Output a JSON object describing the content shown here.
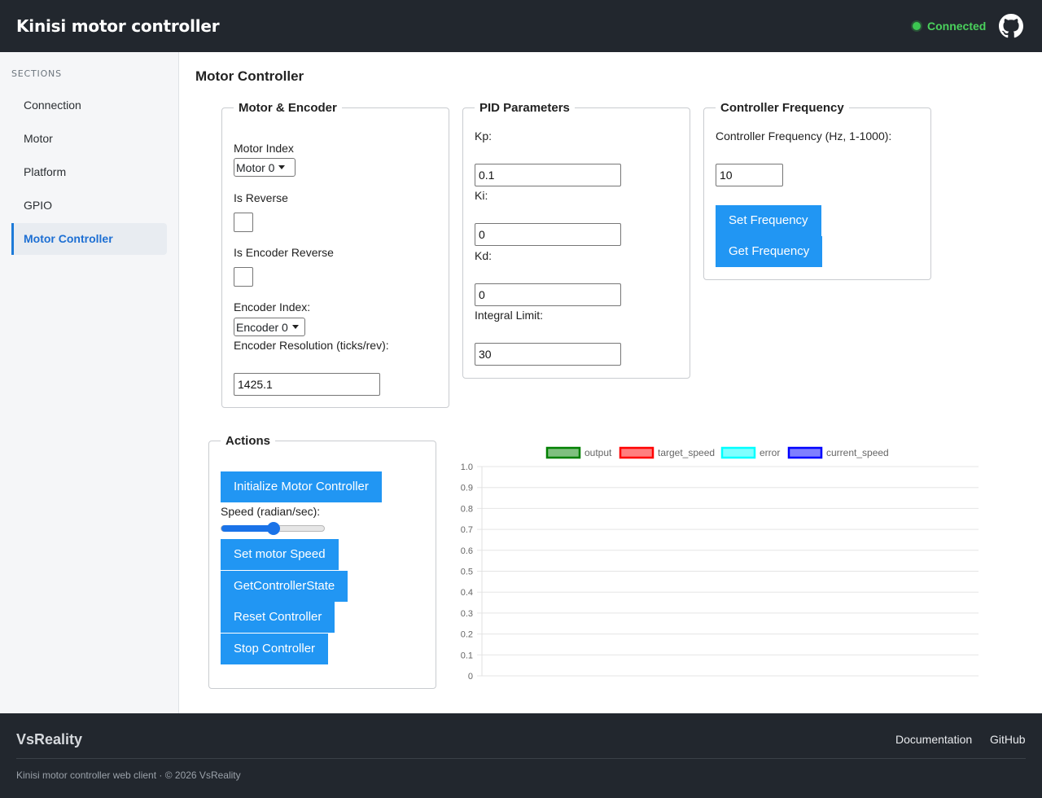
{
  "header": {
    "title": "Kinisi motor controller",
    "status": "Connected",
    "status_color": "#3cc651",
    "repo_icon": "github-icon"
  },
  "sidebar": {
    "heading": "SECTIONS",
    "items": [
      {
        "label": "Connection"
      },
      {
        "label": "Motor"
      },
      {
        "label": "Platform"
      },
      {
        "label": "GPIO"
      },
      {
        "label": "Motor Controller",
        "active": true
      }
    ]
  },
  "main": {
    "title": "Motor Controller",
    "motor_encoder": {
      "legend": "Motor & Encoder",
      "motor_index_label": "Motor Index",
      "motor_index_value": "Motor 0",
      "is_reverse_label": "Is Reverse",
      "is_reverse_checked": false,
      "is_encoder_reverse_label": "Is Encoder Reverse",
      "is_encoder_reverse_checked": false,
      "encoder_index_label": "Encoder Index:",
      "encoder_index_value": "Encoder 0",
      "encoder_resolution_label": "Encoder Resolution (ticks/rev):",
      "encoder_resolution_value": "1425.1"
    },
    "pid": {
      "legend": "PID Parameters",
      "kp_label": "Kp:",
      "kp_value": "0.1",
      "ki_label": "Ki:",
      "ki_value": "0",
      "kd_label": "Kd:",
      "kd_value": "0",
      "integral_limit_label": "Integral Limit:",
      "integral_limit_value": "30"
    },
    "frequency": {
      "legend": "Controller Frequency",
      "label": "Controller Frequency (Hz, 1-1000):",
      "value": "10",
      "set_button": "Set Frequency",
      "get_button": "Get Frequency"
    },
    "actions": {
      "legend": "Actions",
      "init_button": "Initialize Motor Controller",
      "speed_label": "Speed (radian/sec):",
      "speed_slider_fraction": 0.5,
      "set_speed_button": "Set motor Speed",
      "get_state_button": "GetControllerState",
      "reset_button": "Reset Controller",
      "stop_button": "Stop Controller"
    },
    "accent_color": "#2196f3"
  },
  "chart_data": {
    "type": "line",
    "title": "",
    "xlabel": "",
    "ylabel": "",
    "ylim": [
      0,
      1.0
    ],
    "yticks": [
      "1.0",
      "0.9",
      "0.8",
      "0.7",
      "0.6",
      "0.5",
      "0.4",
      "0.3",
      "0.2",
      "0.1",
      "0"
    ],
    "grid": true,
    "legend_position": "top",
    "x": [],
    "series": [
      {
        "name": "output",
        "color": "#008000",
        "values": []
      },
      {
        "name": "target_speed",
        "color": "#ff0000",
        "values": []
      },
      {
        "name": "error",
        "color": "#00ffff",
        "values": []
      },
      {
        "name": "current_speed",
        "color": "#0000ff",
        "values": []
      }
    ]
  },
  "footer": {
    "brand": "VsReality",
    "links": [
      "Documentation",
      "GitHub"
    ],
    "copyright": "Kinisi motor controller web client · © 2026 VsReality"
  }
}
